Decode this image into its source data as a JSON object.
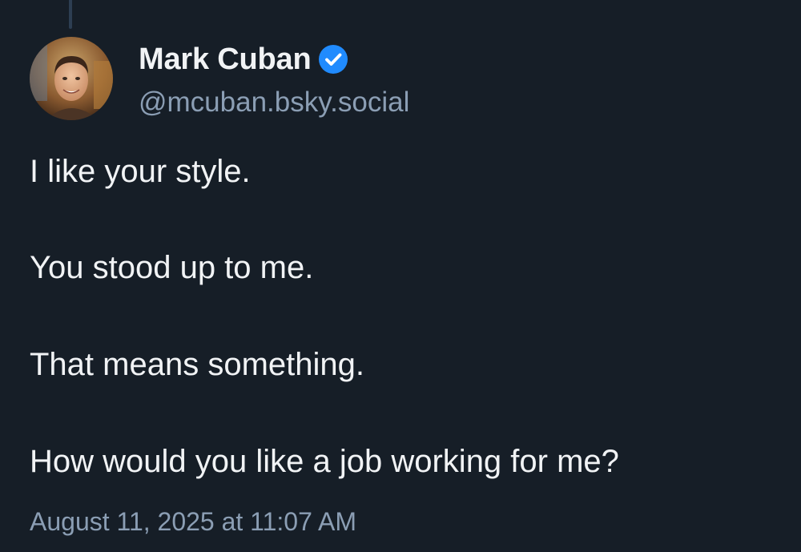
{
  "author": {
    "display_name": "Mark Cuban",
    "handle": "@mcuban.bsky.social",
    "verified": true,
    "avatar_icon": "profile-photo-avatar",
    "verified_icon": "verified-check-icon"
  },
  "post": {
    "paragraphs": [
      "I like your style.",
      "You stood up to me.",
      "That means something.",
      "How would you like a job working for me?"
    ],
    "timestamp": "August 11, 2025 at 11:07 AM"
  },
  "colors": {
    "background": "#161e27",
    "primary_text": "#f1f3f5",
    "secondary_text": "#8b9eb4",
    "verified_blue": "#208bfe",
    "thread_line": "#2d3e52"
  }
}
